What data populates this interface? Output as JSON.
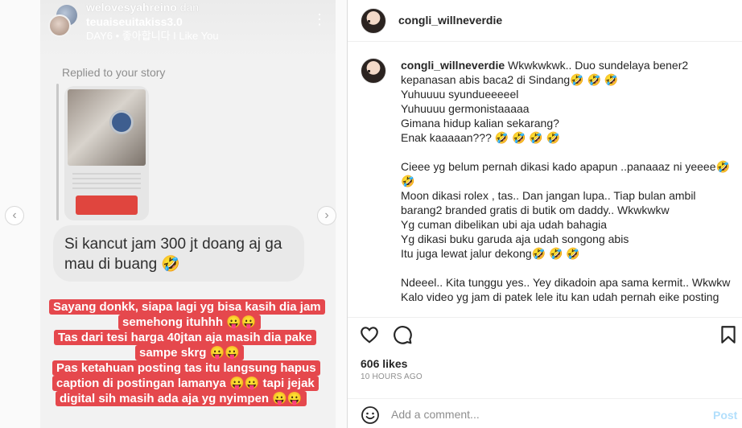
{
  "story": {
    "user1": "welovesyahreino",
    "connector": "dan",
    "user2": "teuaiseuitakiss3.0",
    "song": "DAY6 • 좋아합니다 I Like You",
    "replied_label": "Replied to your story",
    "reply_text": "Si kancut jam 300 jt doang aj ga mau di buang 🤣",
    "caption_lines": [
      "Sayang donkk, siapa lagi yg bisa kasih dia jam",
      "semehong ituhhh 😛😛",
      "Tas dari tesi harga 40jtan aja masih dia pake",
      "sampe skrg 😛😛",
      "Pas ketahuan posting tas itu langsung hapus",
      "caption di postingan lamanya 😛😛 tapi jejak",
      "digital sih masih ada aja yg nyimpen 😛😛"
    ]
  },
  "nav": {
    "prev_icon": "chevron-left-icon",
    "next_icon": "chevron-right-icon",
    "prev": "‹",
    "next": "›"
  },
  "header": {
    "username": "congli_willneverdie"
  },
  "comment": {
    "username": "congli_willneverdie",
    "first_text": " Wkwkwkwk.. Duo sundelaya bener2",
    "lines": [
      "kepanasan abis baca2 di Sindang🤣 🤣 🤣",
      "Yuhuuuu syundueeeeel",
      "Yuhuuuu germonistaaaaa",
      "Gimana hidup kalian sekarang?",
      "Enak kaaaaan??? 🤣 🤣 🤣 🤣",
      "",
      "Cieee yg belum pernah dikasi kado apapun ..panaaaz ni yeeee🤣",
      "🤣",
      "Moon dikasi rolex , tas.. Dan jangan lupa.. Tiap bulan ambil",
      "barang2 branded gratis di butik om daddy.. Wkwkwkw",
      "Yg cuman dibelikan ubi aja udah bahagia",
      "Yg dikasi buku garuda aja udah songong abis",
      "Itu juga lewat jalur dekong🤣 🤣 🤣",
      "",
      "Ndeeel.. Kita tunggu yes.. Yey dikadoin apa sama kermit.. Wkwkw",
      "Kalo video yg jam di patek lele itu kan udah pernah eike posting"
    ]
  },
  "actions": {
    "like_icon": "heart-icon",
    "comment_icon": "comment-icon",
    "save_icon": "bookmark-icon"
  },
  "likes": "606 likes",
  "time_ago": "10 HOURS AGO",
  "add_comment": {
    "placeholder": "Add a comment...",
    "post_label": "Post",
    "emoji_icon": "smile-icon"
  },
  "colors": {
    "caption_bg": "#e5484d",
    "post_disabled": "#b2dffc",
    "muted": "#8e8e8e"
  }
}
